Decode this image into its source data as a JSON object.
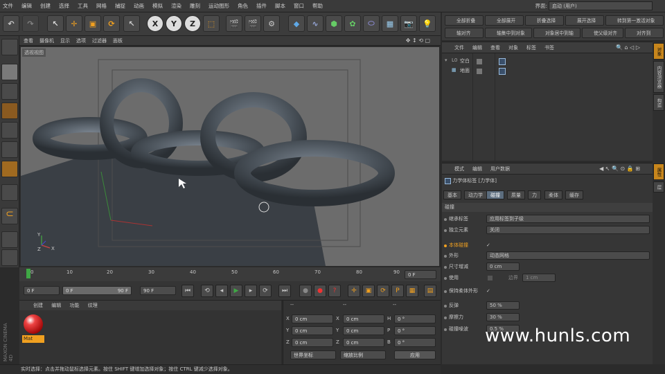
{
  "menu": [
    "文件",
    "编辑",
    "创建",
    "选择",
    "工具",
    "网格",
    "捕捉",
    "动画",
    "模拟",
    "渲染",
    "雕刻",
    "运动图形",
    "角色",
    "插件",
    "脚本",
    "窗口",
    "帮助"
  ],
  "layout": {
    "label": "界面:",
    "value": "启动 (用户)"
  },
  "toolbar": {
    "x": "X",
    "y": "Y",
    "z": "Z"
  },
  "right_toolbar": [
    "全部折叠",
    "全部展开",
    "折叠选择",
    "展开选择",
    "转到第一激活对象",
    "轴对齐",
    "轴集中到对象",
    "对象居中到轴",
    "使父级对齐",
    "对齐到"
  ],
  "viewport": {
    "menu": [
      "查看",
      "摄像机",
      "显示",
      "选项",
      "过滤器",
      "面板"
    ],
    "label": "透视视图",
    "axis_y": "Y",
    "axis_x": "X",
    "axis_z": "Z"
  },
  "timeline": {
    "ticks": [
      "0",
      "10",
      "20",
      "30",
      "40",
      "50",
      "60",
      "70",
      "80",
      "90"
    ],
    "end_field": "0 F"
  },
  "controls": {
    "start": "0 F",
    "range_start": "0 F",
    "range_end": "90 F",
    "end": "90 F"
  },
  "materials": {
    "menu": [
      "创建",
      "编辑",
      "功能",
      "纹理"
    ],
    "item": "Mat"
  },
  "coords": {
    "headers": [
      "--",
      "--",
      "--"
    ],
    "rows": [
      {
        "a": "X",
        "av": "0 cm",
        "b": "X",
        "bv": "0 cm",
        "c": "H",
        "cv": "0 °"
      },
      {
        "a": "Y",
        "av": "0 cm",
        "b": "Y",
        "bv": "0 cm",
        "c": "P",
        "cv": "0 °"
      },
      {
        "a": "Z",
        "av": "0 cm",
        "b": "Z",
        "bv": "0 cm",
        "c": "B",
        "cv": "0 °"
      }
    ],
    "mode1": "世界坐标",
    "mode2": "缩放比例",
    "apply": "应用"
  },
  "status": "实时选择：点击并拖动鼠标选择元素。按住 SHIFT 键增加选择对象；按住 CTRL 键减少选择对象。",
  "object_manager": {
    "menu": [
      "文件",
      "编辑",
      "查看",
      "对象",
      "标签",
      "书签"
    ],
    "items": [
      "空白",
      "地面"
    ]
  },
  "attributes": {
    "menu": [
      "模式",
      "编辑",
      "用户数据"
    ],
    "title": "力学体标签 [力学体]",
    "tabs": [
      "基本",
      "动力学",
      "碰撞",
      "质量",
      "力",
      "柔体",
      "缓存"
    ],
    "section": "碰撞",
    "inherit_label": "继承标签",
    "inherit_value": "应用标签到子级",
    "standalone_label": "独立元素",
    "standalone_value": "关闭",
    "self_collision": "本体碰撞",
    "self_collision_check": "✓",
    "shape_label": "外形",
    "shape_value": "动态网格",
    "size_inc_label": "尺寸增减",
    "size_inc_value": "0 cm",
    "use_label": "使用",
    "border_label": "边界",
    "border_value": "1 cm",
    "keep_soft": "保持柔体外形",
    "keep_soft_check": "✓",
    "bounce_label": "反弹",
    "bounce_value": "50 %",
    "friction_label": "摩擦力",
    "friction_value": "30 %",
    "noise_label": "碰撞噪波",
    "noise_value": "0.5 %"
  },
  "side_tabs": [
    "对象",
    "内容浏览器",
    "构造",
    "属性",
    "层"
  ],
  "watermark": "www.hunls.com",
  "colors": {
    "accent": "#f0a020",
    "active_tab": "#5c6d7e"
  }
}
